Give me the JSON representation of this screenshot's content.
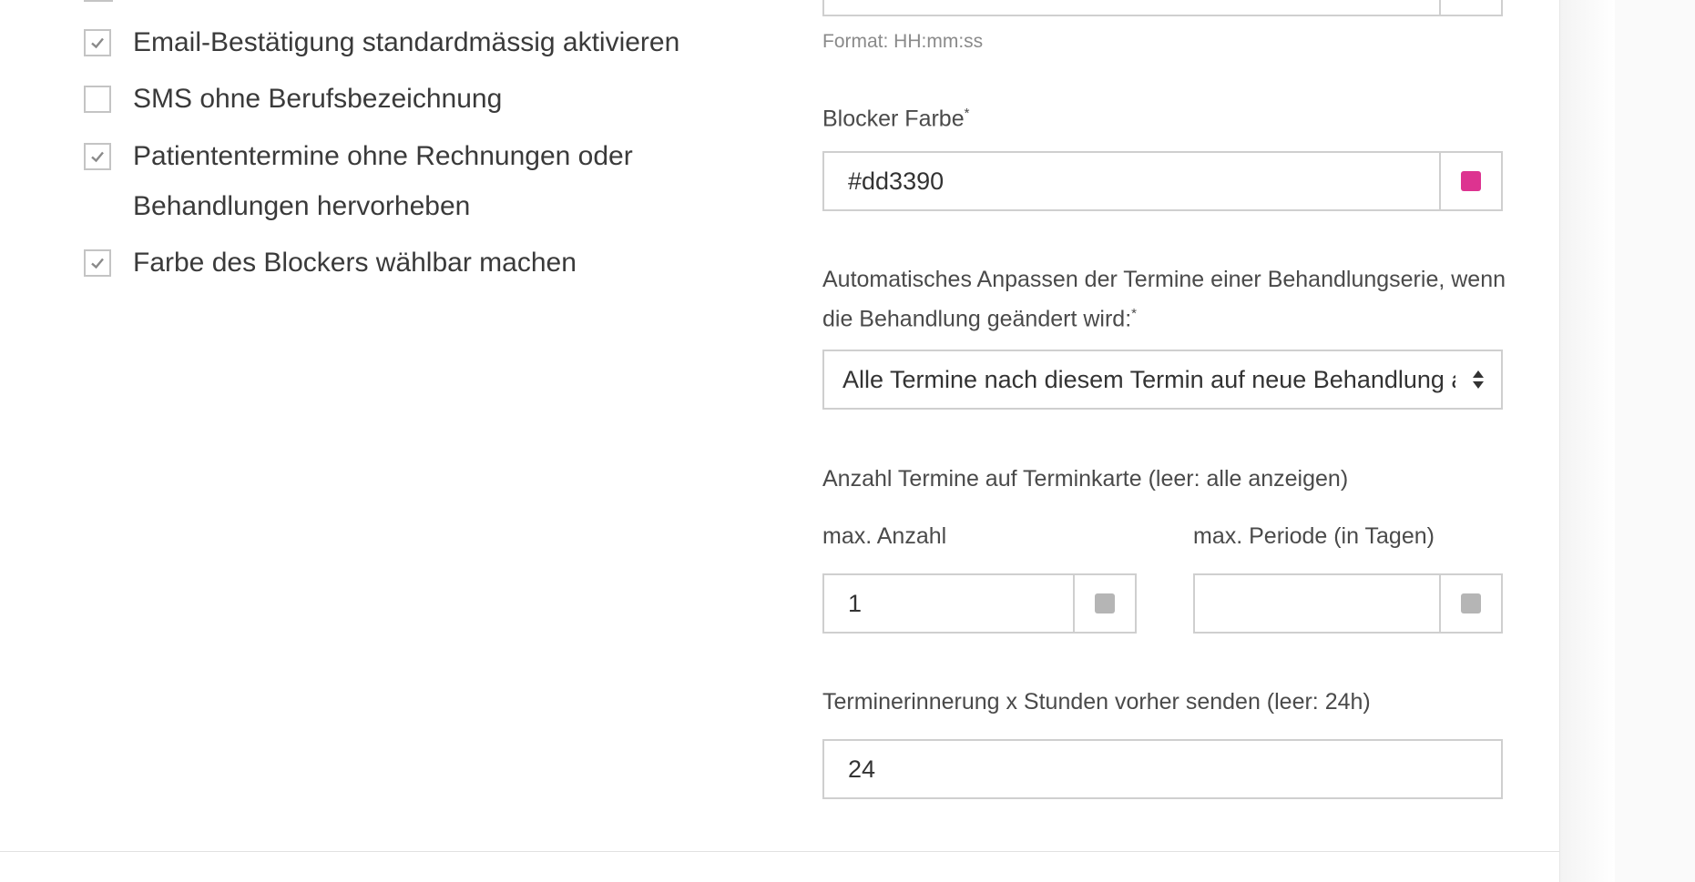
{
  "checkboxes": [
    {
      "label": "Email-Bestätigung standardmässig aktivieren",
      "checked": true
    },
    {
      "label": "SMS ohne Berufsbezeichnung",
      "checked": false
    },
    {
      "label": "Patiententermine ohne Rechnungen oder Behandlungen hervorheben",
      "checked": true
    },
    {
      "label": "Farbe des Blockers wählbar machen",
      "checked": true
    }
  ],
  "time_field": {
    "hint": "Format: HH:mm:ss"
  },
  "blocker_color": {
    "label": "Blocker Farbe",
    "required_mark": "*",
    "value": "#dd3390",
    "swatch_color": "#dd3390"
  },
  "series_adjust": {
    "label": "Automatisches Anpassen der Termine einer Behandlungserie, wenn die Behandlung geändert wird:",
    "required_mark": "*",
    "selected": "Alle Termine nach diesem Termin auf neue Behandlung anpassen"
  },
  "appointment_card": {
    "label": "Anzahl Termine auf Terminkarte (leer: alle anzeigen)",
    "max_count": {
      "label": "max. Anzahl",
      "value": "1"
    },
    "max_period": {
      "label": "max. Periode (in Tagen)",
      "value": ""
    }
  },
  "reminder": {
    "label": "Terminerinnerung x Stunden vorher senden (leer: 24h)",
    "value": "24"
  },
  "colors": {
    "accent": "#dd3390",
    "stepper": "#b5b5b5",
    "check": "#8a8a8a"
  }
}
